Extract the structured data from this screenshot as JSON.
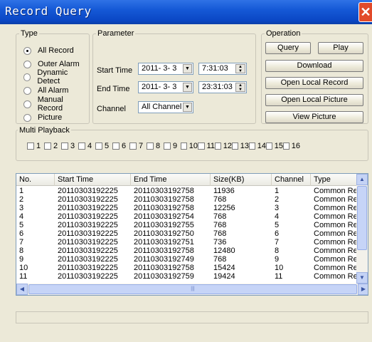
{
  "window": {
    "title": "Record Query",
    "close_glyph": "✕"
  },
  "type_group": {
    "label": "Type",
    "options": [
      {
        "label": "All Record",
        "checked": true
      },
      {
        "label": "Outer Alarm",
        "checked": false
      },
      {
        "label": "Dynamic Detect",
        "checked": false
      },
      {
        "label": "All Alarm",
        "checked": false
      },
      {
        "label": "Manual Record",
        "checked": false
      },
      {
        "label": "Picture",
        "checked": false
      }
    ]
  },
  "parameter_group": {
    "label": "Parameter",
    "start_time_label": "Start Time",
    "start_date": "2011- 3- 3",
    "start_time": "7:31:03",
    "end_time_label": "End Time",
    "end_date": "2011- 3- 3",
    "end_time": "23:31:03",
    "channel_label": "Channel",
    "channel_value": "All Channel"
  },
  "operation_group": {
    "label": "Operation",
    "query": "Query",
    "play": "Play",
    "download": "Download",
    "open_local_record": "Open Local Record",
    "open_local_picture": "Open Local Picture",
    "view_picture": "View Picture"
  },
  "multi_playback": {
    "label": "Multi Playback",
    "channels": [
      "1",
      "2",
      "3",
      "4",
      "5",
      "6",
      "7",
      "8",
      "9",
      "10",
      "11",
      "12",
      "13",
      "14",
      "15",
      "16"
    ]
  },
  "record_list": {
    "columns": [
      "No.",
      "Start Time",
      "End Time",
      "Size(KB)",
      "Channel",
      "Type"
    ],
    "rows": [
      [
        "1",
        "20110303192225",
        "20110303192758",
        "11936",
        "1",
        "Common Record"
      ],
      [
        "2",
        "20110303192225",
        "20110303192758",
        "768",
        "2",
        "Common Record"
      ],
      [
        "3",
        "20110303192225",
        "20110303192758",
        "12256",
        "3",
        "Common Record"
      ],
      [
        "4",
        "20110303192225",
        "20110303192754",
        "768",
        "4",
        "Common Record"
      ],
      [
        "5",
        "20110303192225",
        "20110303192755",
        "768",
        "5",
        "Common Record"
      ],
      [
        "6",
        "20110303192225",
        "20110303192750",
        "768",
        "6",
        "Common Record"
      ],
      [
        "7",
        "20110303192225",
        "20110303192751",
        "736",
        "7",
        "Common Record"
      ],
      [
        "8",
        "20110303192225",
        "20110303192758",
        "12480",
        "8",
        "Common Record"
      ],
      [
        "9",
        "20110303192225",
        "20110303192749",
        "768",
        "9",
        "Common Record"
      ],
      [
        "10",
        "20110303192225",
        "20110303192758",
        "15424",
        "10",
        "Common Record"
      ],
      [
        "11",
        "20110303192225",
        "20110303192759",
        "19424",
        "11",
        "Common Record"
      ]
    ]
  },
  "status": {
    "text": ""
  }
}
